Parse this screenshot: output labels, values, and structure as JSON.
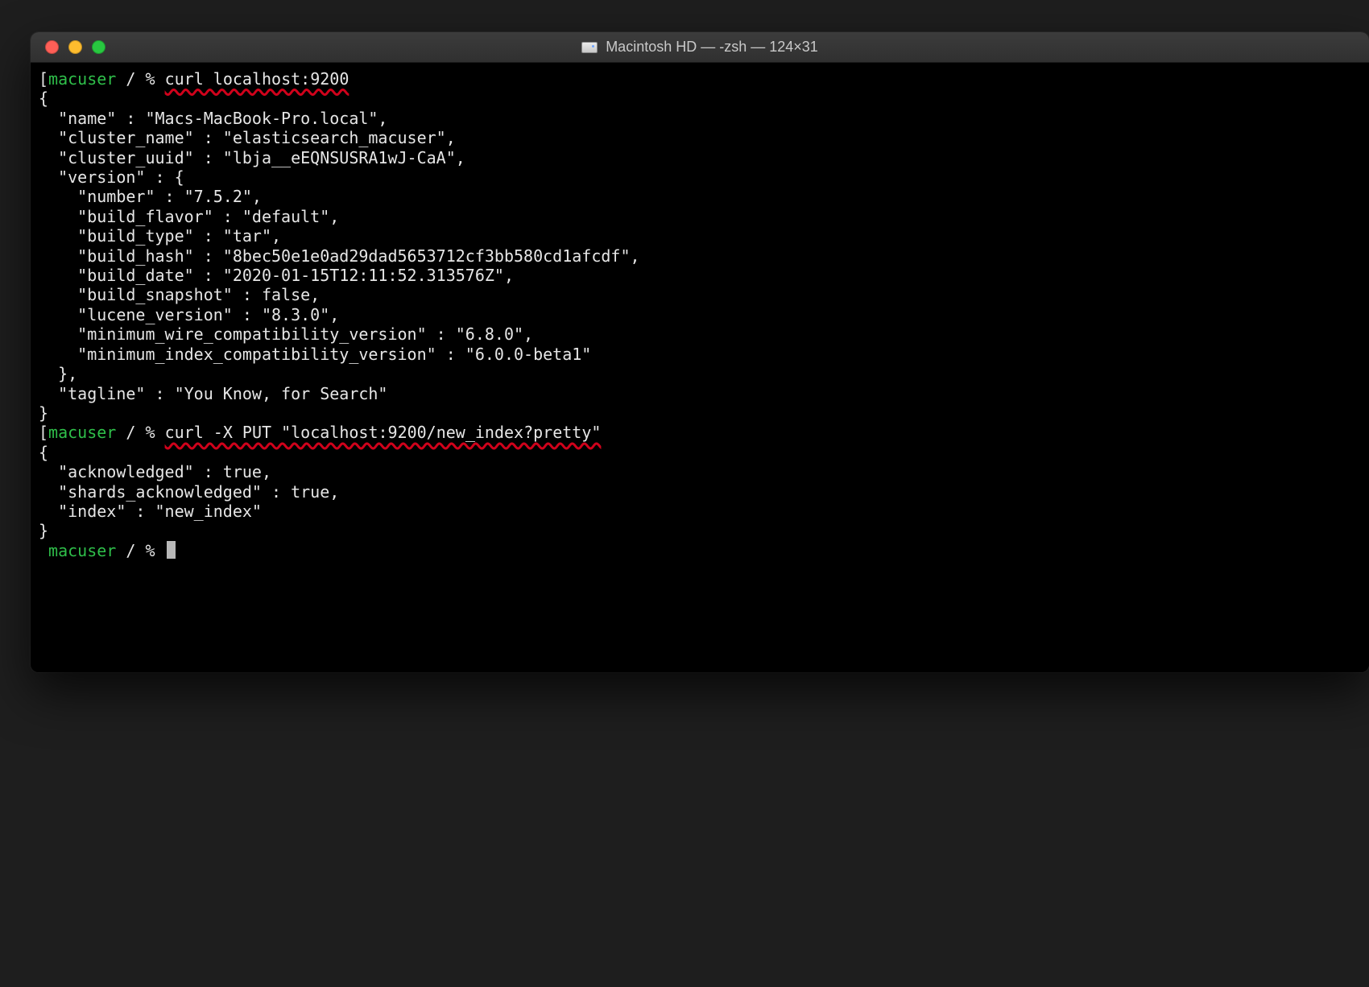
{
  "window": {
    "title": "Macintosh HD — -zsh — 124×31"
  },
  "prompt": {
    "user": "macuser",
    "path": "/",
    "symbol": "%"
  },
  "commands": {
    "cmd1": "curl localhost:9200",
    "cmd2": "curl -X PUT \"localhost:9200/new_index?pretty\""
  },
  "output1_lines": [
    "{",
    "  \"name\" : \"Macs-MacBook-Pro.local\",",
    "  \"cluster_name\" : \"elasticsearch_macuser\",",
    "  \"cluster_uuid\" : \"lbja__eEQNSUSRA1wJ-CaA\",",
    "  \"version\" : {",
    "    \"number\" : \"7.5.2\",",
    "    \"build_flavor\" : \"default\",",
    "    \"build_type\" : \"tar\",",
    "    \"build_hash\" : \"8bec50e1e0ad29dad5653712cf3bb580cd1afcdf\",",
    "    \"build_date\" : \"2020-01-15T12:11:52.313576Z\",",
    "    \"build_snapshot\" : false,",
    "    \"lucene_version\" : \"8.3.0\",",
    "    \"minimum_wire_compatibility_version\" : \"6.8.0\",",
    "    \"minimum_index_compatibility_version\" : \"6.0.0-beta1\"",
    "  },",
    "  \"tagline\" : \"You Know, for Search\"",
    "}"
  ],
  "output2_lines": [
    "{",
    "  \"acknowledged\" : true,",
    "  \"shards_acknowledged\" : true,",
    "  \"index\" : \"new_index\"",
    "}"
  ]
}
